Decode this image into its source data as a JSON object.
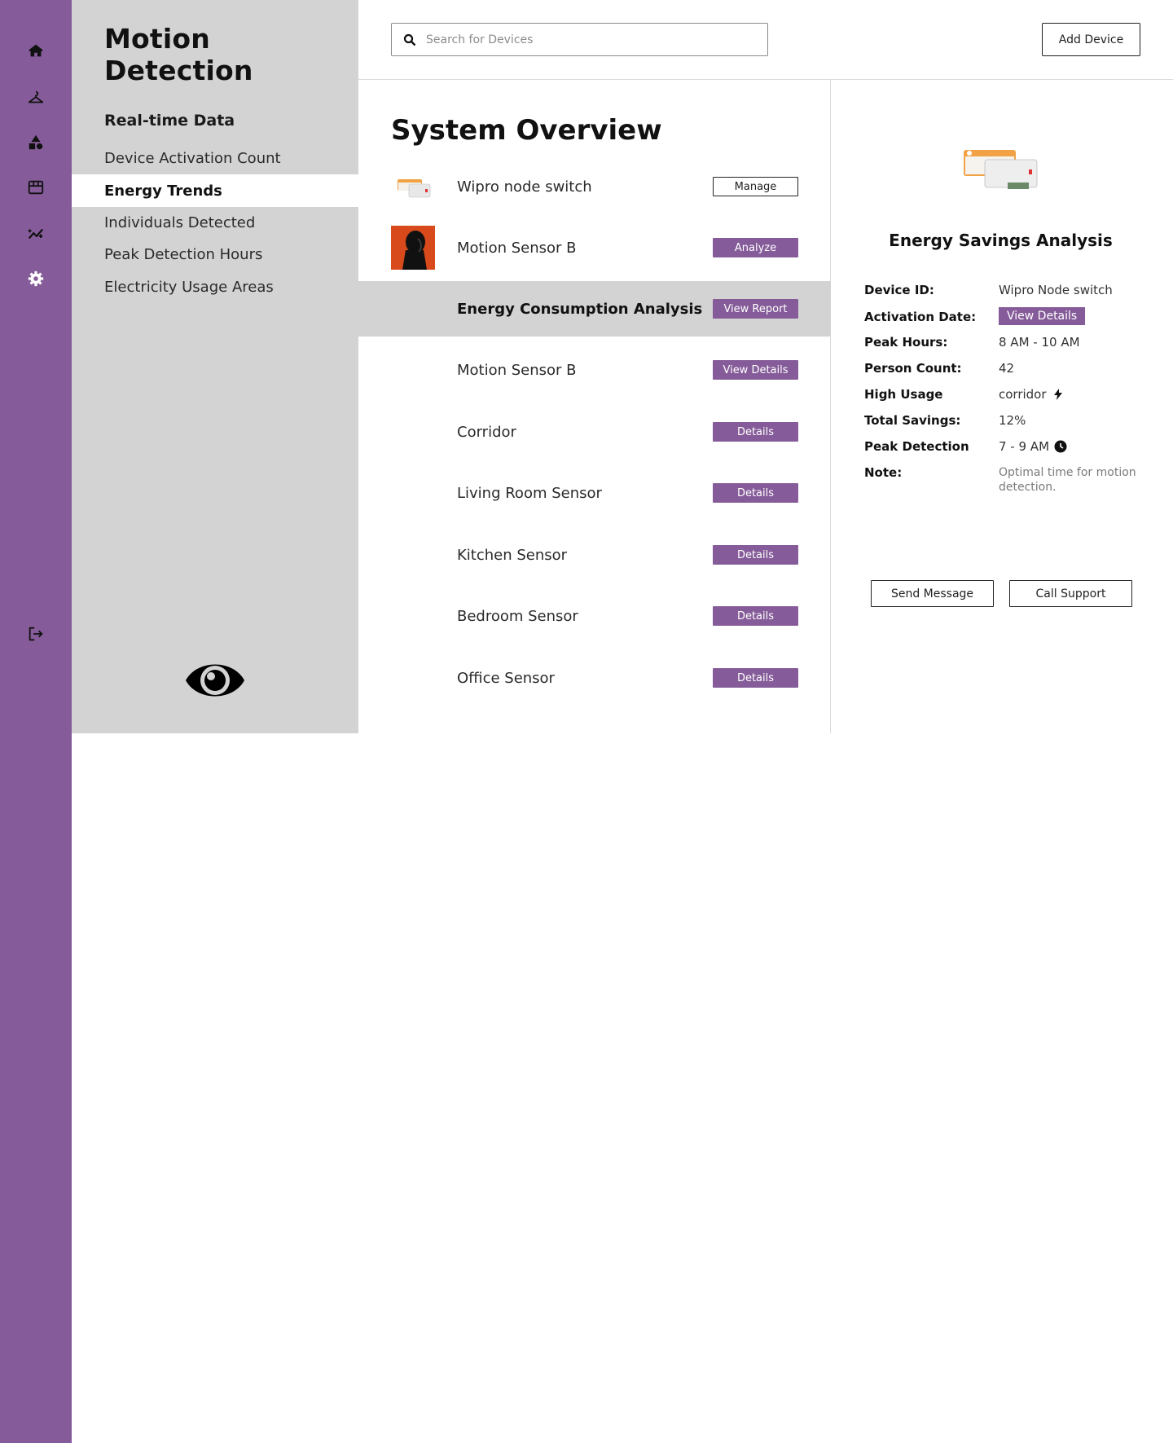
{
  "rail": {
    "icons": [
      "home-icon",
      "hanger-icon",
      "shapes-icon",
      "store-icon",
      "analytics-icon",
      "gear-icon"
    ],
    "logout_icon": "logout-icon"
  },
  "nav": {
    "app_title": "Motion Detection",
    "section_title": "Real-time Data",
    "items": [
      {
        "label": "Device Activation Count",
        "active": false
      },
      {
        "label": "Energy Trends",
        "active": true
      },
      {
        "label": "Individuals Detected",
        "active": false
      },
      {
        "label": "Peak Detection Hours",
        "active": false
      },
      {
        "label": "Electricity Usage Areas",
        "active": false
      }
    ],
    "logo_icon": "eye-icon"
  },
  "header": {
    "search_placeholder": "Search for Devices",
    "add_device_label": "Add Device"
  },
  "main": {
    "title": "System Overview",
    "rows": [
      {
        "label": "Wipro node switch",
        "button": "Manage",
        "style": "outline",
        "thumb": "device-thumbnail"
      },
      {
        "label": "Motion Sensor B",
        "button": "Analyze",
        "style": "filled",
        "thumb": "person-avatar"
      },
      {
        "label": "Energy Consumption Analysis",
        "button": "View Report",
        "style": "filled",
        "highlight": true
      },
      {
        "label": "Motion Sensor B",
        "button": "View Details",
        "style": "filled"
      },
      {
        "label": "Corridor",
        "button": "Details",
        "style": "filled"
      },
      {
        "label": "Living Room Sensor",
        "button": "Details",
        "style": "filled"
      },
      {
        "label": "Kitchen Sensor",
        "button": "Details",
        "style": "filled"
      },
      {
        "label": "Bedroom Sensor",
        "button": "Details",
        "style": "filled"
      },
      {
        "label": "Office Sensor",
        "button": "Details",
        "style": "filled"
      }
    ]
  },
  "detail": {
    "title": "Energy Savings Analysis",
    "fields": {
      "device_id_label": "Device ID:",
      "device_id_value": "Wipro Node switch",
      "activation_label": "Activation Date:",
      "activation_button": "View Details",
      "peak_hours_label": "Peak Hours:",
      "peak_hours_value": "8 AM - 10 AM",
      "person_count_label": "Person Count:",
      "person_count_value": "42",
      "high_usage_label": "High Usage",
      "high_usage_value": "corridor",
      "high_usage_icon": "bolt-icon",
      "total_savings_label": "Total Savings:",
      "total_savings_value": "12%",
      "peak_detection_label": "Peak Detection",
      "peak_detection_value": "7 - 9 AM",
      "peak_detection_icon": "clock-icon",
      "note_label": "Note:",
      "note_value": "Optimal time for motion detection."
    },
    "send_message_label": "Send Message",
    "call_support_label": "Call Support"
  },
  "colors": {
    "accent": "#855c99",
    "panel_grey": "#d3d3d3"
  }
}
